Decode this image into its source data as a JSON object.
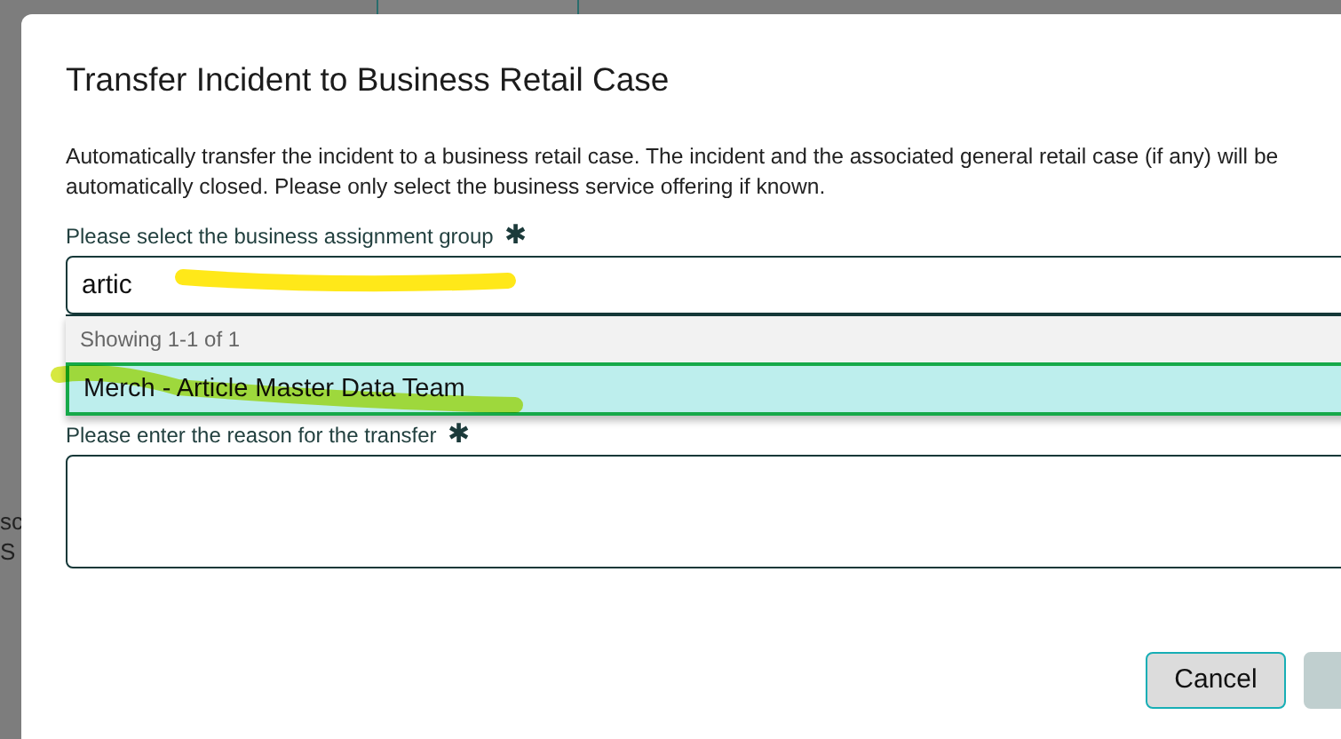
{
  "background": {
    "texts": [
      "sc",
      "S"
    ]
  },
  "dialog": {
    "title": "Transfer Incident to Business Retail Case",
    "description": "Automatically transfer the incident to a business retail case. The incident and the associated general retail case (if any) will be automatically closed. Please only select the business service offering if known.",
    "group_field": {
      "label": "Please select the business assignment group",
      "required_mark": "✱",
      "value": "artic"
    },
    "dropdown": {
      "summary": "Showing 1-1 of 1",
      "options": [
        {
          "label": "Merch - Article Master Data Team",
          "selected": true
        }
      ]
    },
    "reason_field": {
      "label": "Please enter the reason for the transfer",
      "required_mark": "✱"
    },
    "buttons": [
      {
        "label": "Cancel",
        "disabled": false
      },
      {
        "disabled": true
      }
    ]
  }
}
